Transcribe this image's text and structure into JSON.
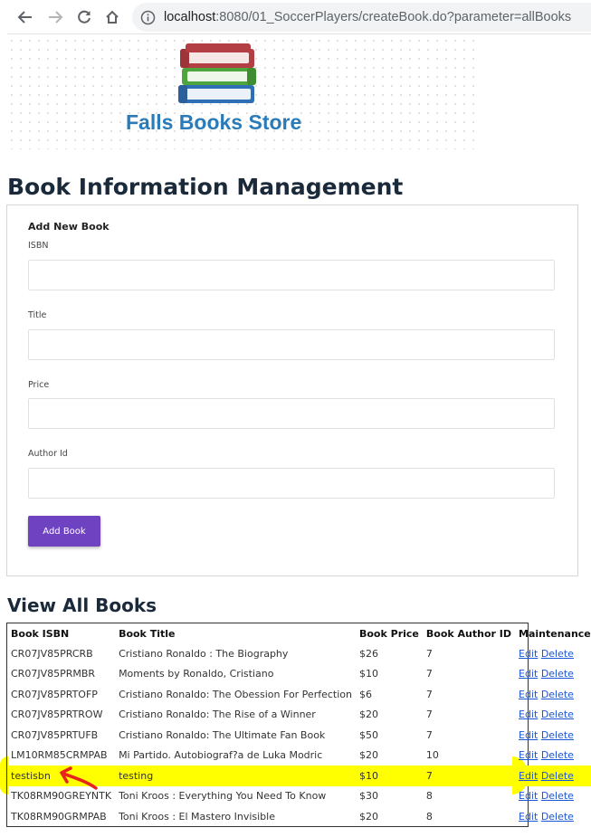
{
  "browser": {
    "url_host": "localhost",
    "url_rest": ":8080/01_SoccerPlayers/createBook.do?parameter=allBooks"
  },
  "logo": {
    "store_name": "Falls Books Store"
  },
  "page": {
    "title": "Book Information Management",
    "view_title": "View All Books"
  },
  "form": {
    "title": "Add New Book",
    "isbn_label": "ISBN",
    "title_label": "Title",
    "price_label": "Price",
    "author_label": "Author Id",
    "isbn_value": "",
    "title_value": "",
    "price_value": "",
    "author_value": "",
    "submit_label": "Add Book",
    "accent_color": "#6f42c1"
  },
  "table": {
    "headers": [
      "Book ISBN",
      "Book Title",
      "Book Price",
      "Book Author ID",
      "Maintenance"
    ],
    "edit_label": "Edit",
    "delete_label": "Delete",
    "rows": [
      {
        "isbn": "CR07JV85PRCRB",
        "title": "Cristiano Ronaldo : The Biography",
        "price": "$26",
        "author": "7"
      },
      {
        "isbn": "CR07JV85PRMBR",
        "title": "Moments by Ronaldo, Cristiano",
        "price": "$10",
        "author": "7"
      },
      {
        "isbn": "CR07JV85PRTOFP",
        "title": "Cristiano Ronaldo: The Obession For Perfection",
        "price": "$6",
        "author": "7"
      },
      {
        "isbn": "CR07JV85PRTROW",
        "title": "Cristiano Ronaldo: The Rise of a Winner",
        "price": "$20",
        "author": "7"
      },
      {
        "isbn": "CR07JV85PRTUFB",
        "title": "Cristiano Ronaldo: The Ultimate Fan Book",
        "price": "$50",
        "author": "7"
      },
      {
        "isbn": "LM10RM85CRMPAB",
        "title": "Mi Partido. Autobiograf?a de Luka Modric",
        "price": "$20",
        "author": "10"
      },
      {
        "isbn": "testisbn",
        "title": "testing",
        "price": "$10",
        "author": "7"
      },
      {
        "isbn": "TK08RM90GREYNTK",
        "title": "Toni Kroos : Everything You Need To Know",
        "price": "$30",
        "author": "8"
      },
      {
        "isbn": "TK08RM90GRMPAB",
        "title": "Toni Kroos : El Mastero Invisible",
        "price": "$20",
        "author": "8"
      }
    ],
    "highlight_color": "#ffff00",
    "annotation_color": "#e8231b"
  }
}
